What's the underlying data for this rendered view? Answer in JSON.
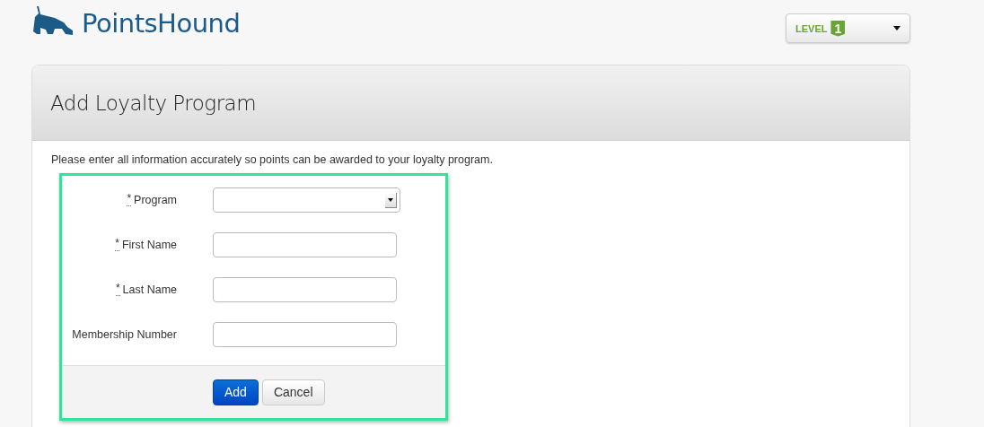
{
  "brand": {
    "name": "PointsHound"
  },
  "level_menu": {
    "label": "LEVEL",
    "level": "1"
  },
  "card": {
    "title": "Add Loyalty Program",
    "intro": "Please enter all information accurately so points can be awarded to your loyalty program.",
    "fields": [
      {
        "label": "Program",
        "required_mark": "*",
        "kind": "select"
      },
      {
        "label": "First Name",
        "required_mark": "*",
        "kind": "text"
      },
      {
        "label": "Last Name",
        "required_mark": "*",
        "kind": "text"
      },
      {
        "label": "Membership Number",
        "kind": "text"
      }
    ],
    "buttons": [
      {
        "label": "Add",
        "kind": "primary"
      },
      {
        "label": "Cancel",
        "kind": "default"
      }
    ]
  }
}
